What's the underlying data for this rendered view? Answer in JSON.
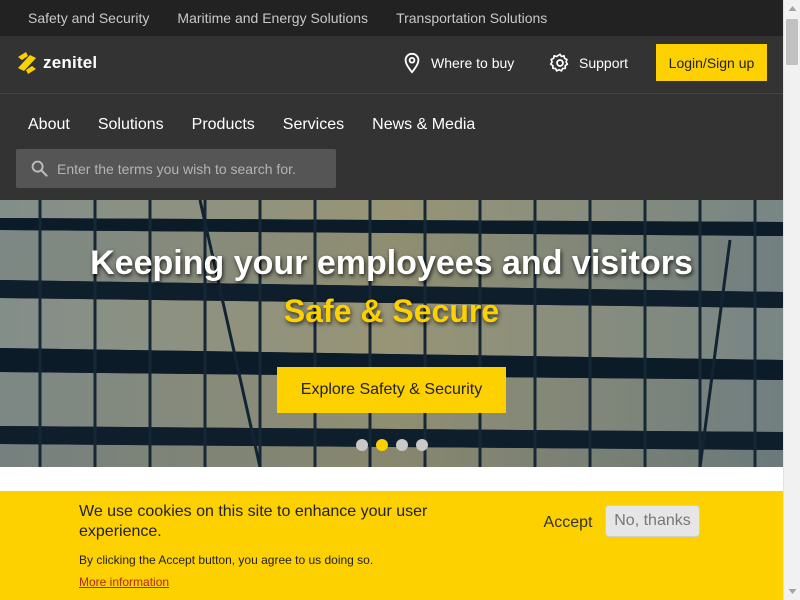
{
  "topbar": {
    "links": [
      "Safety and Security",
      "Maritime and Energy Solutions",
      "Transportation Solutions"
    ]
  },
  "header": {
    "logo_text": "zenitel",
    "where_to_buy": "Where to buy",
    "support": "Support",
    "login": "Login/Sign up"
  },
  "nav": {
    "items": [
      "About",
      "Solutions",
      "Products",
      "Services",
      "News & Media"
    ]
  },
  "search": {
    "placeholder": "Enter the terms you wish to search for."
  },
  "hero": {
    "title": "Keeping your employees and visitors",
    "subtitle": "Safe & Secure",
    "cta": "Explore Safety & Security",
    "slides": 4,
    "active_slide": 2
  },
  "cookie": {
    "message": "We use cookies on this site to enhance your user experience.",
    "note": "By clicking the Accept button, you agree to us doing so.",
    "more": "More information",
    "accept": "Accept",
    "decline": "No, thanks"
  },
  "colors": {
    "brand_yellow": "#fdd000",
    "header_bg": "#333333",
    "topbar_bg": "#222222"
  }
}
